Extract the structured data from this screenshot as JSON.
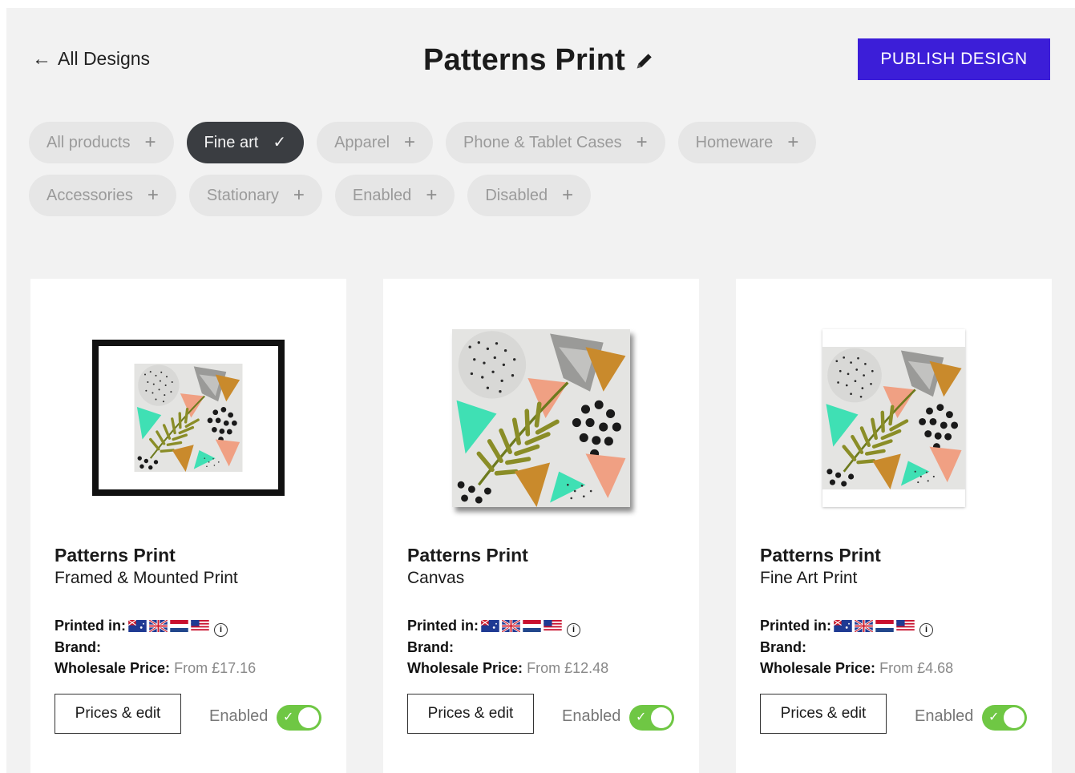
{
  "header": {
    "back_label": "All Designs",
    "title": "Patterns Print",
    "publish_label": "PUBLISH DESIGN",
    "publish_color": "#3c1ed8"
  },
  "filters": {
    "row1": [
      {
        "label": "All products",
        "active": false
      },
      {
        "label": "Fine art",
        "active": true
      },
      {
        "label": "Apparel",
        "active": false
      },
      {
        "label": "Phone & Tablet Cases",
        "active": false
      },
      {
        "label": "Homeware",
        "active": false
      }
    ],
    "row2": [
      {
        "label": "Accessories",
        "active": false
      },
      {
        "label": "Stationary",
        "active": false
      },
      {
        "label": "Enabled",
        "active": false
      },
      {
        "label": "Disabled",
        "active": false
      }
    ]
  },
  "products": [
    {
      "name": "Patterns Print",
      "type": "Framed & Mounted Print",
      "printed_in_label": "Printed in:",
      "brand_label": "Brand:",
      "wholesale_label": "Wholesale Price:",
      "wholesale_value": "From £17.16",
      "edit_label": "Prices & edit",
      "status_label": "Enabled"
    },
    {
      "name": "Patterns Print",
      "type": "Canvas",
      "printed_in_label": "Printed in:",
      "brand_label": "Brand:",
      "wholesale_label": "Wholesale Price:",
      "wholesale_value": "From £12.48",
      "edit_label": "Prices & edit",
      "status_label": "Enabled"
    },
    {
      "name": "Patterns Print",
      "type": "Fine Art Print",
      "printed_in_label": "Printed in:",
      "brand_label": "Brand:",
      "wholesale_label": "Wholesale Price:",
      "wholesale_value": "From £4.68",
      "edit_label": "Prices & edit",
      "status_label": "Enabled"
    }
  ],
  "colors": {
    "toggle_on": "#6fc744",
    "chip_active": "#3a3d41",
    "chip_inactive": "#e6e6e6"
  },
  "icons": {
    "back": "arrow-left-icon",
    "edit_title": "pencil-icon",
    "chip_add": "plus-icon",
    "chip_selected": "check-icon",
    "info": "info-icon",
    "flags": [
      "australia-flag-icon",
      "uk-flag-icon",
      "netherlands-flag-icon",
      "usa-flag-icon"
    ]
  }
}
